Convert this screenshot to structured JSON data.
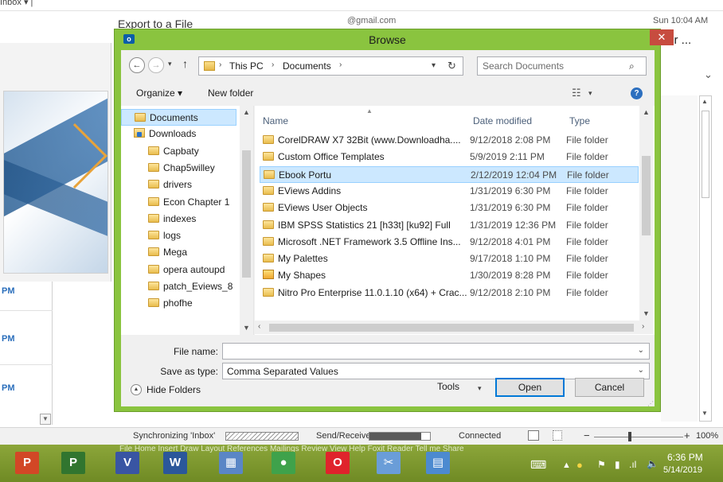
{
  "background": {
    "top_strip": "Inbox ▾ | ",
    "export_title": "Export to a File",
    "email": "@gmail.com",
    "time": "Sun 10:04 AM",
    "side_text": "for ...",
    "pm_labels": [
      "PM",
      "PM",
      "PM"
    ]
  },
  "dialog": {
    "title": "Browse",
    "close_label": "✕",
    "nav": {
      "back": "←",
      "forward": "→",
      "up": "↑",
      "breadcrumb": [
        "This PC",
        "Documents"
      ]
    },
    "search": {
      "placeholder": "Search Documents"
    },
    "toolbar": {
      "organize": "Organize ▾",
      "new_folder": "New folder"
    },
    "nav_pane": [
      {
        "label": "Documents",
        "icon": "folder-icon",
        "selected": true,
        "indent": 0
      },
      {
        "label": "Downloads",
        "icon": "downloads-icon",
        "selected": false,
        "indent": 0
      },
      {
        "label": "Capbaty",
        "icon": "folder-icon",
        "selected": false,
        "indent": 1
      },
      {
        "label": "Chap5willey",
        "icon": "folder-icon",
        "selected": false,
        "indent": 1
      },
      {
        "label": "drivers",
        "icon": "folder-icon",
        "selected": false,
        "indent": 1
      },
      {
        "label": "Econ Chapter 1",
        "icon": "folder-icon",
        "selected": false,
        "indent": 1
      },
      {
        "label": "indexes",
        "icon": "folder-icon",
        "selected": false,
        "indent": 1
      },
      {
        "label": "logs",
        "icon": "folder-icon",
        "selected": false,
        "indent": 1
      },
      {
        "label": "Mega",
        "icon": "folder-icon",
        "selected": false,
        "indent": 1
      },
      {
        "label": "opera autoupd",
        "icon": "folder-icon",
        "selected": false,
        "indent": 1
      },
      {
        "label": "patch_Eviews_8",
        "icon": "folder-icon",
        "selected": false,
        "indent": 1
      },
      {
        "label": "phofhe",
        "icon": "folder-icon",
        "selected": false,
        "indent": 1
      }
    ],
    "columns": {
      "name": "Name",
      "date": "Date modified",
      "type": "Type"
    },
    "files": [
      {
        "name": "CorelDRAW X7 32Bit (www.Downloadha....",
        "date": "9/12/2018 2:08 PM",
        "type": "File folder",
        "selected": false
      },
      {
        "name": "Custom Office Templates",
        "date": "5/9/2019 2:11 PM",
        "type": "File folder",
        "selected": false
      },
      {
        "name": "Ebook Portu",
        "date": "2/12/2019 12:04 PM",
        "type": "File folder",
        "selected": true
      },
      {
        "name": "EViews Addins",
        "date": "1/31/2019 6:30 PM",
        "type": "File folder",
        "selected": false
      },
      {
        "name": "EViews User Objects",
        "date": "1/31/2019 6:30 PM",
        "type": "File folder",
        "selected": false
      },
      {
        "name": "IBM SPSS Statistics 21 [h33t] [ku92] Full",
        "date": "1/31/2019 12:36 PM",
        "type": "File folder",
        "selected": false
      },
      {
        "name": "Microsoft .NET Framework 3.5 Offline Ins...",
        "date": "9/12/2018 4:01 PM",
        "type": "File folder",
        "selected": false
      },
      {
        "name": "My Palettes",
        "date": "9/17/2018 1:10 PM",
        "type": "File folder",
        "selected": false
      },
      {
        "name": "My Shapes",
        "date": "1/30/2019 8:28 PM",
        "type": "File folder",
        "selected": false
      },
      {
        "name": "Nitro Pro Enterprise 11.0.1.10 (x64) + Crac...",
        "date": "9/12/2018 2:10 PM",
        "type": "File folder",
        "selected": false
      }
    ],
    "file_name_label": "File name:",
    "file_name_value": "",
    "save_type_label": "Save as type:",
    "save_type_value": "Comma Separated Values",
    "hide_folders": "Hide Folders",
    "tools": "Tools",
    "open": "Open",
    "cancel": "Cancel"
  },
  "statusbar": {
    "sync": "Synchronizing 'Inbox'",
    "send_receive": "Send/Receive",
    "send_receive_progress": 0.85,
    "connected": "Connected",
    "zoom_minus": "−",
    "zoom_plus": "+",
    "zoom": "100%"
  },
  "taskbar": {
    "ribbon_ghost": "File   Home   Insert   Draw   Layout   References   Mailings   Review   View   Help   Foxit Reader   Tell me   Share",
    "tray_time": "6:36 PM",
    "tray_date": "5/14/2019",
    "apps": [
      {
        "name": "powerpoint",
        "glyph": "P",
        "color": "#d24726"
      },
      {
        "name": "project",
        "glyph": "P",
        "color": "#31752f"
      },
      {
        "name": "visio",
        "glyph": "V",
        "color": "#3955a3"
      },
      {
        "name": "word",
        "glyph": "W",
        "color": "#2b579a"
      },
      {
        "name": "network",
        "glyph": "▦",
        "color": "#5a86c6"
      },
      {
        "name": "media",
        "glyph": "●",
        "color": "#3fa24b"
      },
      {
        "name": "opera",
        "glyph": "O",
        "color": "#e0232c"
      },
      {
        "name": "snipping",
        "glyph": "✂",
        "color": "#6a9dd8"
      },
      {
        "name": "calculator",
        "glyph": "▤",
        "color": "#4c8ad0"
      }
    ]
  }
}
